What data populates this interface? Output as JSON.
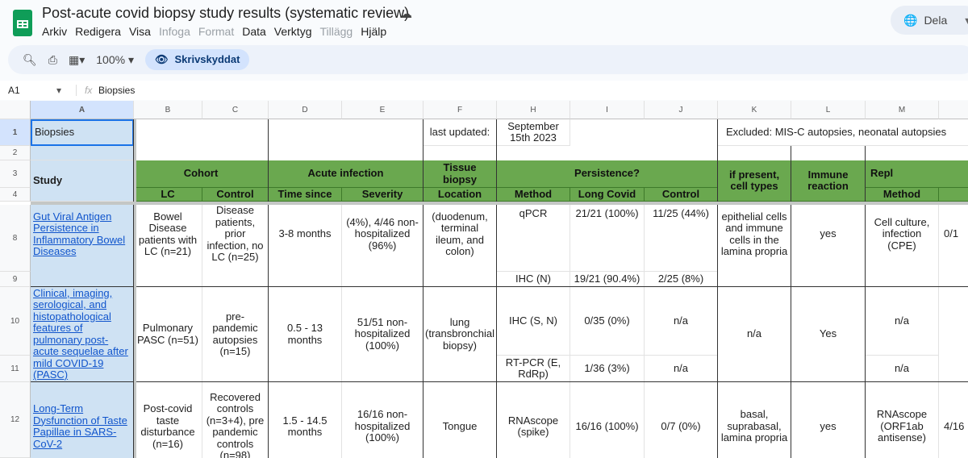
{
  "app": {
    "title": "Post-acute covid biopsy study results (systematic review)",
    "share_label": "Dela",
    "menu": [
      {
        "label": "Arkiv",
        "enabled": true
      },
      {
        "label": "Redigera",
        "enabled": true
      },
      {
        "label": "Visa",
        "enabled": true
      },
      {
        "label": "Infoga",
        "enabled": false
      },
      {
        "label": "Format",
        "enabled": false
      },
      {
        "label": "Data",
        "enabled": true
      },
      {
        "label": "Verktyg",
        "enabled": true
      },
      {
        "label": "Tillägg",
        "enabled": false
      },
      {
        "label": "Hjälp",
        "enabled": true
      }
    ]
  },
  "toolbar": {
    "zoom": "100%",
    "readonly_label": "Skrivskyddat"
  },
  "formula_bar": {
    "cell_ref": "A1",
    "fx": "fx",
    "value": "Biopsies"
  },
  "columns": [
    "A",
    "B",
    "C",
    "D",
    "E",
    "F",
    "H",
    "I",
    "J",
    "K",
    "L",
    "M",
    ""
  ],
  "rows": [
    "1",
    "2",
    "3",
    "4",
    "8",
    "9",
    "10",
    "11",
    "12"
  ],
  "colors": {
    "header_green": "#6aa84f",
    "study_blue": "#cfe2f3",
    "link": "#1155cc"
  },
  "cells": {
    "A1": "Biopsies",
    "F1": "last updated:",
    "H1": "September\n15th 2023",
    "K1": "Excluded: MIS-C autopsies, neonatal autopsies",
    "A3": "Study",
    "B3": "Cohort",
    "D3": "Acute infection",
    "F3": "Tissue biopsy",
    "H3": "Persistence?",
    "K3": "if present, cell types",
    "L3": "Immune reaction",
    "M3": "Repl",
    "B4": "LC",
    "C4": "Control",
    "D4": "Time since",
    "E4": "Severity",
    "F4": "Location",
    "H4": "Method",
    "I4": "Long Covid",
    "J4": "Control",
    "M4": "Method",
    "A8": "Gut Viral Antigen Persistence in Inflammatory Bowel Diseases",
    "B8": "Bowel Disease patients with LC (n=21)",
    "C8": "Disease patients, prior infection, no LC (n=25)",
    "D8": "3-8 months",
    "E8": "(4%), 4/46 non-hospitalized (96%)",
    "F8": "(duodenum, terminal ileum, and colon)",
    "H8": "qPCR",
    "I8": "21/21 (100%)",
    "J8": "11/25 (44%)",
    "K8": "epithelial cells and immune cells in the lamina propria",
    "L8": "yes",
    "M8": "Cell culture, infection (CPE)",
    "N8": "0/1",
    "H9": "IHC (N)",
    "I9": "19/21 (90.4%)",
    "J9": "2/25 (8%)",
    "A10": "Clinical, imaging, serological, and histopathological features of pulmonary post-acute sequelae after mild COVID-19 (PASC)",
    "B10": "Pulmonary PASC (n=51)",
    "C10": "pre-pandemic autopsies (n=15)",
    "D10": "0.5 - 13 months",
    "E10": "51/51 non-hospitalized (100%)",
    "F10": "lung (transbronchial biopsy)",
    "H10": "IHC (S, N)",
    "I10": "0/35 (0%)",
    "J10": "n/a",
    "K10": "n/a",
    "L10": "Yes",
    "M10": "n/a",
    "H11": "RT-PCR (E, RdRp)",
    "I11": "1/36 (3%)",
    "J11": "n/a",
    "M11": "n/a",
    "A12": "Long-Term Dysfunction of Taste Papillae in SARS-CoV-2",
    "B12": "Post-covid taste disturbance (n=16)",
    "C12": "Recovered controls (n=3+4), pre pandemic controls (n=98)",
    "D12": "1.5 - 14.5 months",
    "E12": "16/16 non-hospitalized (100%)",
    "F12": "Tongue",
    "H12": "RNAscope (spike)",
    "I12": "16/16 (100%)",
    "J12": "0/7 (0%)",
    "K12": "basal, suprabasal, lamina propria",
    "L12": "yes",
    "M12": "RNAscope (ORF1ab antisense)",
    "N12": "4/16"
  }
}
